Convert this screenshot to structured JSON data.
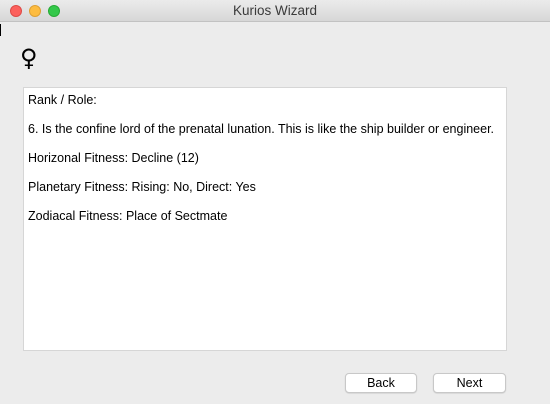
{
  "window": {
    "title": "Kurios Wizard"
  },
  "planet": {
    "glyph": "♀",
    "icon": "venus-symbol-icon"
  },
  "content": {
    "lines": [
      "Rank / Role:",
      "6. Is the confine lord of the prenatal lunation.  This is like the ship builder or engineer.",
      "Horizonal Fitness: Decline (12)",
      "Planetary Fitness: Rising: No, Direct: Yes",
      "Zodiacal Fitness: Place of Sectmate"
    ]
  },
  "buttons": {
    "back_label": "Back",
    "next_label": "Next"
  },
  "colors": {
    "close": "#fc605c",
    "minimize": "#fdbc40",
    "zoom": "#34c84a",
    "window_bg": "#ececec",
    "content_bg": "#ffffff"
  }
}
